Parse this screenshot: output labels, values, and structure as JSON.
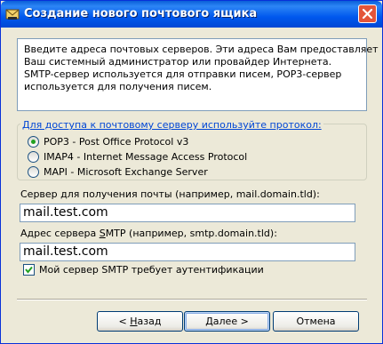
{
  "window": {
    "title": "Создание нового почтового ящика",
    "title_icon": "mailbox-icon",
    "close_icon": "close-icon"
  },
  "info": {
    "lines": [
      "Введите адреса почтовых серверов. Эти адреса Вам предоставляет",
      "Ваш системный администратор или провайдер Интернета.",
      "SMTP-сервер используется для отправки писем, POP3-сервер",
      "используется для получения писем."
    ]
  },
  "protocol": {
    "legend": "Для доступа к почтовому серверу используйте протокол:",
    "options": [
      {
        "label": "POP3  -  Post Office Protocol v3",
        "checked": true
      },
      {
        "label": "IMAP4 - Internet Message Access Protocol",
        "checked": false
      },
      {
        "label": "MAPI - Microsoft Exchange Server",
        "checked": false
      }
    ]
  },
  "incoming": {
    "label": "Сервер для получения почты  (например, mail.domain.tld):",
    "value": "mail.test.com"
  },
  "smtp": {
    "label_pre": "Адрес сервера ",
    "label_ul": "S",
    "label_post": "MTP (например, smtp.domain.tld):",
    "value": "mail.test.com"
  },
  "auth": {
    "label": "Мой сервер SMTP требует аутентификации",
    "checked": true
  },
  "buttons": {
    "back_pre": "< ",
    "back_ul": "Н",
    "back_post": "азад",
    "next_ul": "Д",
    "next_post": "алее >",
    "cancel": "Отмена"
  },
  "colors": {
    "titlebar": "#0058ee",
    "dialog_bg": "#ece9d8",
    "legend_text": "#0046d5",
    "radio_check": "#21a121",
    "checkbox_check": "#21a121"
  }
}
